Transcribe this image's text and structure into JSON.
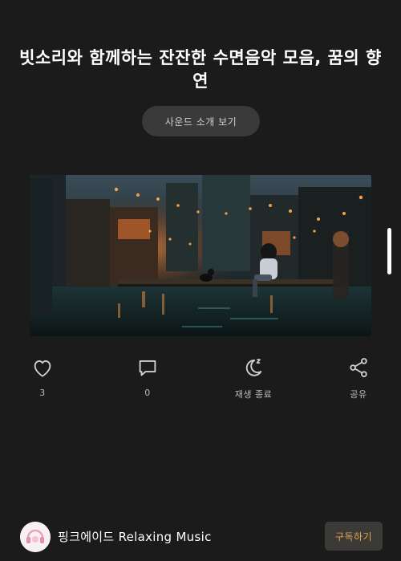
{
  "post": {
    "title": "빗소리와 함께하는 잔잔한 수면음악 모음, 꿈의 향연",
    "intro_button_label": "사운드 소개 보기"
  },
  "actions": {
    "like": {
      "icon": "heart-icon",
      "count": "3"
    },
    "comment": {
      "icon": "comment-icon",
      "count": "0"
    },
    "sleep_timer": {
      "icon": "moon-sleep-icon",
      "label": "재생 종료"
    },
    "share": {
      "icon": "share-icon",
      "label": "공유"
    }
  },
  "channel": {
    "name": "핑크에이드 Relaxing Music",
    "subscribe_label": "구독하기"
  },
  "colors": {
    "background": "#1b1b1b",
    "subscribe_text": "#e0a552",
    "button_bg": "#3a3a3a"
  }
}
